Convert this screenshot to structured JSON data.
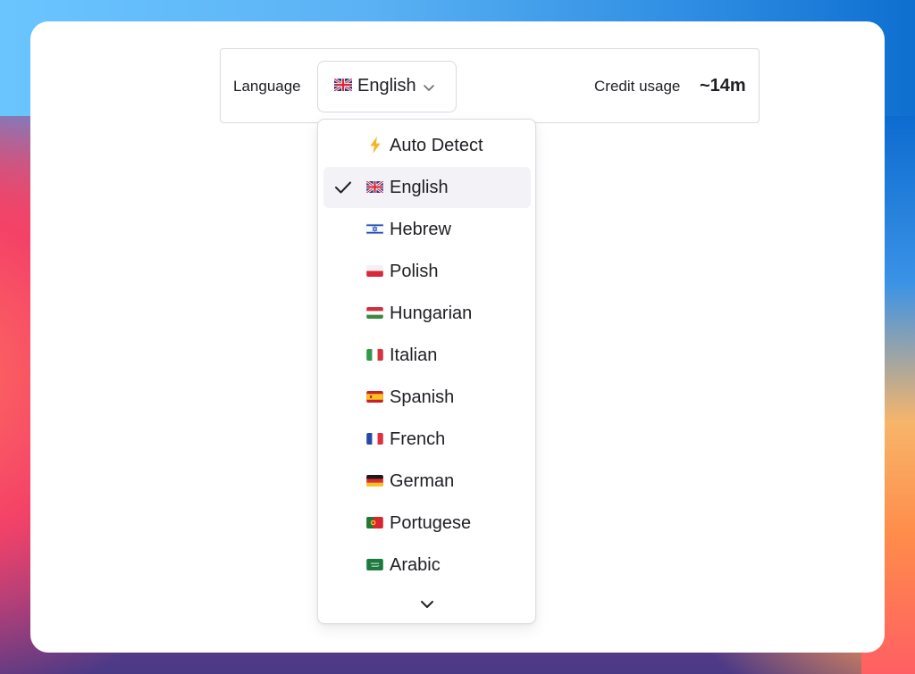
{
  "toolbar": {
    "language_label": "Language",
    "selected_language": "English",
    "selected_flag_icon": "uk-flag-icon",
    "credit_label": "Credit usage",
    "credit_value": "~14m"
  },
  "dropdown": {
    "options": [
      {
        "label": "Auto Detect",
        "icon": "lightning-icon",
        "selected": false
      },
      {
        "label": "English",
        "icon": "uk-flag-icon",
        "selected": true
      },
      {
        "label": "Hebrew",
        "icon": "israel-flag-icon",
        "selected": false
      },
      {
        "label": "Polish",
        "icon": "poland-flag-icon",
        "selected": false
      },
      {
        "label": "Hungarian",
        "icon": "hungary-flag-icon",
        "selected": false
      },
      {
        "label": "Italian",
        "icon": "italy-flag-icon",
        "selected": false
      },
      {
        "label": "Spanish",
        "icon": "spain-flag-icon",
        "selected": false
      },
      {
        "label": "French",
        "icon": "france-flag-icon",
        "selected": false
      },
      {
        "label": "German",
        "icon": "germany-flag-icon",
        "selected": false
      },
      {
        "label": "Portugese",
        "icon": "portugal-flag-icon",
        "selected": false
      },
      {
        "label": "Arabic",
        "icon": "saudi-flag-icon",
        "selected": false
      }
    ],
    "scroll_icon": "chevron-down-icon"
  },
  "colors": {
    "text": "#1f1f24",
    "border": "#d9d9e0",
    "selected_bg": "#f3f2f7"
  }
}
